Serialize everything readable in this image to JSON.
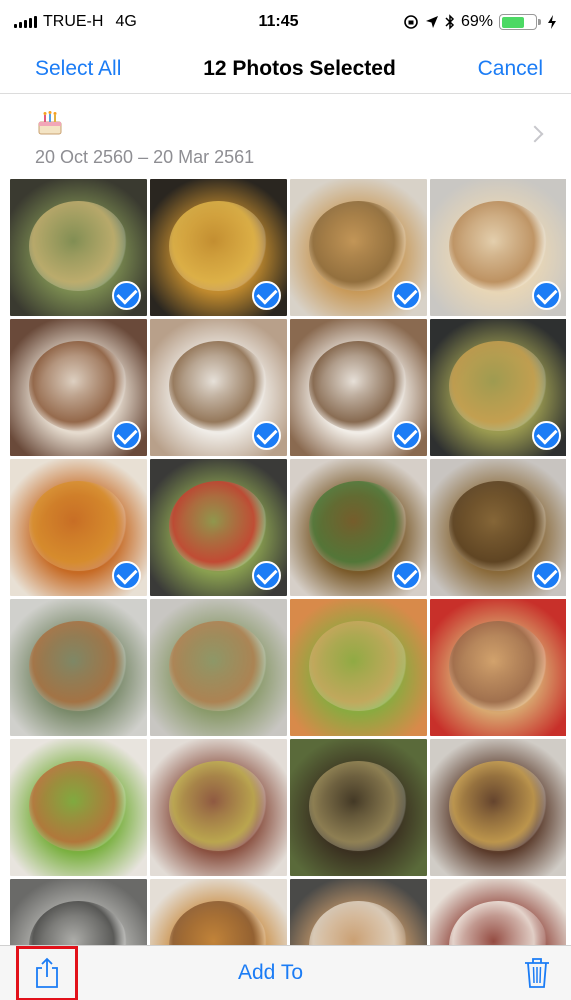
{
  "status_bar": {
    "carrier": "TRUE-H",
    "network": "4G",
    "time": "11:45",
    "battery_percent": "69%",
    "battery_level": 0.69
  },
  "nav": {
    "select_all": "Select All",
    "title": "12 Photos Selected",
    "cancel": "Cancel"
  },
  "moment": {
    "date_range": "20 Oct 2560 – 20 Mar 2561",
    "icon": "birthday-cake-icon"
  },
  "photos": [
    {
      "name": "som-tam-salad",
      "selected": true,
      "colors": [
        "#3a3a30",
        "#7a8a50",
        "#c4b070"
      ]
    },
    {
      "name": "omelette-bowl",
      "selected": true,
      "colors": [
        "#2a2620",
        "#c08a2e",
        "#e0b54a"
      ]
    },
    {
      "name": "fried-noodles",
      "selected": true,
      "colors": [
        "#d8d2c8",
        "#c89a5a",
        "#8c6a3a"
      ]
    },
    {
      "name": "shrimp-plate",
      "selected": true,
      "colors": [
        "#c9c7c3",
        "#e8d6b6",
        "#b88a58"
      ]
    },
    {
      "name": "restaurant-table",
      "selected": true,
      "colors": [
        "#6a4a3a",
        "#e6dccf",
        "#8a5a3a"
      ]
    },
    {
      "name": "cappuccino-1",
      "selected": true,
      "colors": [
        "#b8a08a",
        "#f0ede8",
        "#8a6a4a"
      ]
    },
    {
      "name": "cappuccino-2",
      "selected": true,
      "colors": [
        "#8a6a50",
        "#f2eee8",
        "#7a5a3e"
      ]
    },
    {
      "name": "papaya-salad",
      "selected": true,
      "colors": [
        "#2e3030",
        "#9a9a50",
        "#c8a050"
      ]
    },
    {
      "name": "tom-yum-soup",
      "selected": true,
      "colors": [
        "#e8e0d4",
        "#c66a24",
        "#d8902e"
      ]
    },
    {
      "name": "veggie-bowl",
      "selected": true,
      "colors": [
        "#3a3a38",
        "#8aa050",
        "#c84030"
      ]
    },
    {
      "name": "stir-fry-plate",
      "selected": true,
      "colors": [
        "#d6cfc8",
        "#7a5a2a",
        "#4e7a3a"
      ]
    },
    {
      "name": "curry-bowl",
      "selected": true,
      "colors": [
        "#c8c4c0",
        "#8a6a3a",
        "#5a4020"
      ]
    },
    {
      "name": "rice-and-fish",
      "selected": false,
      "colors": [
        "#d0d0cc",
        "#7a8a6a",
        "#a87040"
      ]
    },
    {
      "name": "rice-plate-2",
      "selected": false,
      "colors": [
        "#c8c6c2",
        "#8a9a6a",
        "#b08050"
      ]
    },
    {
      "name": "green-salad",
      "selected": false,
      "colors": [
        "#d88a4a",
        "#8aaa40",
        "#c8a860"
      ]
    },
    {
      "name": "beef-noodles",
      "selected": false,
      "colors": [
        "#c8302a",
        "#d8a870",
        "#9a6a4a"
      ]
    },
    {
      "name": "spaghetti-lettuce",
      "selected": false,
      "colors": [
        "#e8e4de",
        "#7ab040",
        "#b8703a"
      ]
    },
    {
      "name": "dipping-sauce",
      "selected": false,
      "colors": [
        "#e2dcd6",
        "#8a5040",
        "#c0b050"
      ]
    },
    {
      "name": "herb-platter",
      "selected": false,
      "colors": [
        "#5a6a3a",
        "#3a3020",
        "#9a8a5a"
      ]
    },
    {
      "name": "meat-rice-bowl",
      "selected": false,
      "colors": [
        "#d0ccc6",
        "#5a3a2a",
        "#c8a050"
      ]
    },
    {
      "name": "plastic-bag",
      "selected": false,
      "colors": [
        "#6a6a68",
        "#b8b8b4",
        "#4a4a48"
      ]
    },
    {
      "name": "soup-bowl",
      "selected": false,
      "colors": [
        "#e4ded6",
        "#c8883a",
        "#8a5a30"
      ]
    },
    {
      "name": "grilled-dish",
      "selected": false,
      "colors": [
        "#4a4a48",
        "#c89a6a",
        "#e0d4c4"
      ]
    },
    {
      "name": "dessert-bowl",
      "selected": false,
      "colors": [
        "#e6ded6",
        "#8a3a30",
        "#f0e8e0"
      ]
    }
  ],
  "toolbar": {
    "share_icon": "share-icon",
    "add_to": "Add To",
    "trash_icon": "trash-icon"
  },
  "colors": {
    "accent": "#1b7cf5",
    "highlight": "#e2111a",
    "battery": "#4cd964"
  }
}
